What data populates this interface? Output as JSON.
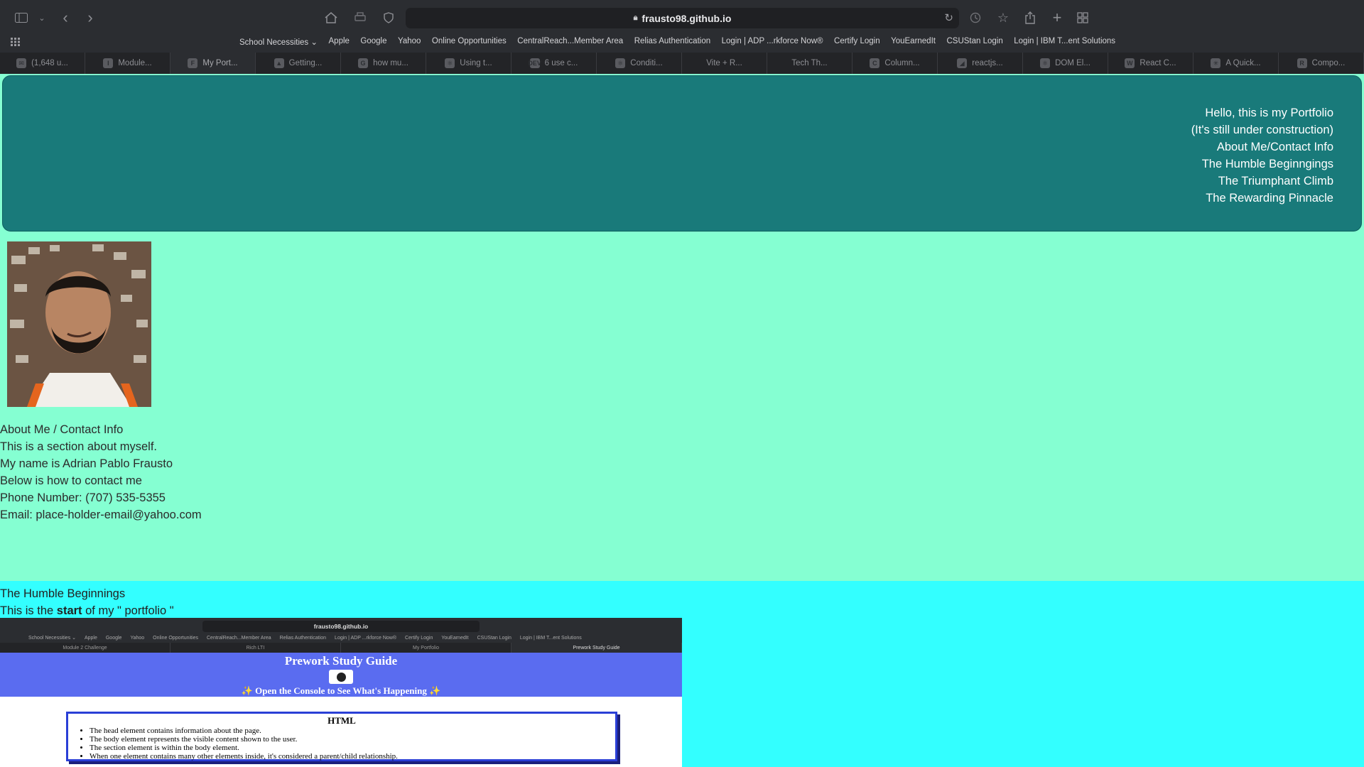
{
  "browser": {
    "url": "frausto98.github.io",
    "bookmarks": [
      "School Necessities ⌄",
      "Apple",
      "Google",
      "Yahoo",
      "Online Opportunities",
      "CentralReach...Member Area",
      "Relias Authentication",
      "Login | ADP ...rkforce Now®",
      "Certify Login",
      "YouEarnedIt",
      "CSUStan Login",
      "Login | IBM T...ent Solutions"
    ],
    "tabs": [
      {
        "label": "(1,648 u...",
        "fav": "✉"
      },
      {
        "label": "Module...",
        "fav": "I"
      },
      {
        "label": "My Port...",
        "fav": "F"
      },
      {
        "label": "Getting...",
        "fav": "▲"
      },
      {
        "label": "how mu...",
        "fav": "G"
      },
      {
        "label": "Using t...",
        "fav": "⚛"
      },
      {
        "label": "6 use c...",
        "fav": "DEV"
      },
      {
        "label": "Conditi...",
        "fav": "⚛"
      },
      {
        "label": "Vite + R...",
        "fav": ""
      },
      {
        "label": "Tech Th...",
        "fav": ""
      },
      {
        "label": "Column...",
        "fav": "C"
      },
      {
        "label": "reactjs...",
        "fav": "◢"
      },
      {
        "label": "DOM El...",
        "fav": "⚛"
      },
      {
        "label": "React C...",
        "fav": "W"
      },
      {
        "label": "A Quick...",
        "fav": "✳"
      },
      {
        "label": "Compo...",
        "fav": "R"
      }
    ]
  },
  "hero": {
    "links": [
      "Hello, this is my Portfolio",
      "(It's still under construction)",
      "About Me/Contact Info",
      "The Humble Beginngings",
      "The Triumphant Climb",
      "The Rewarding Pinnacle"
    ]
  },
  "about": {
    "heading": "About Me / Contact Info",
    "lines": [
      "This is a section about myself.",
      "My name is Adrian Pablo Frausto",
      "Below is how to contact me",
      "Phone Number: (707) 535-5355",
      "Email: place-holder-email@yahoo.com"
    ]
  },
  "humble": {
    "heading": "The Humble Beginnings",
    "intro_pre": "This is the ",
    "intro_bold": "start",
    "intro_post": " of my \" portfolio \""
  },
  "screenshot": {
    "url": "frausto98.github.io",
    "bookmarks": [
      "School Necessities ⌄",
      "Apple",
      "Google",
      "Yahoo",
      "Online Opportunities",
      "CentralReach...Member Area",
      "Relias Authentication",
      "Login | ADP ...rkforce Now®",
      "Certify Login",
      "YouEarnedIt",
      "CSUStan Login",
      "Login | IBM T...ent Solutions"
    ],
    "tabs": [
      "Module 2 Challenge",
      "Rich LTI",
      "My Portfolio",
      "Prework Study Guide"
    ],
    "title": "Prework Study Guide",
    "subtitle": "✨ Open the Console to See What's Happening ✨",
    "card_heading": "HTML",
    "card_items": [
      "The head element contains information about the page.",
      "The body element represents the visible content shown to the user.",
      "The section element is within the body element.",
      "When one element contains many other elements inside, it's considered a parent/child relationship."
    ]
  }
}
